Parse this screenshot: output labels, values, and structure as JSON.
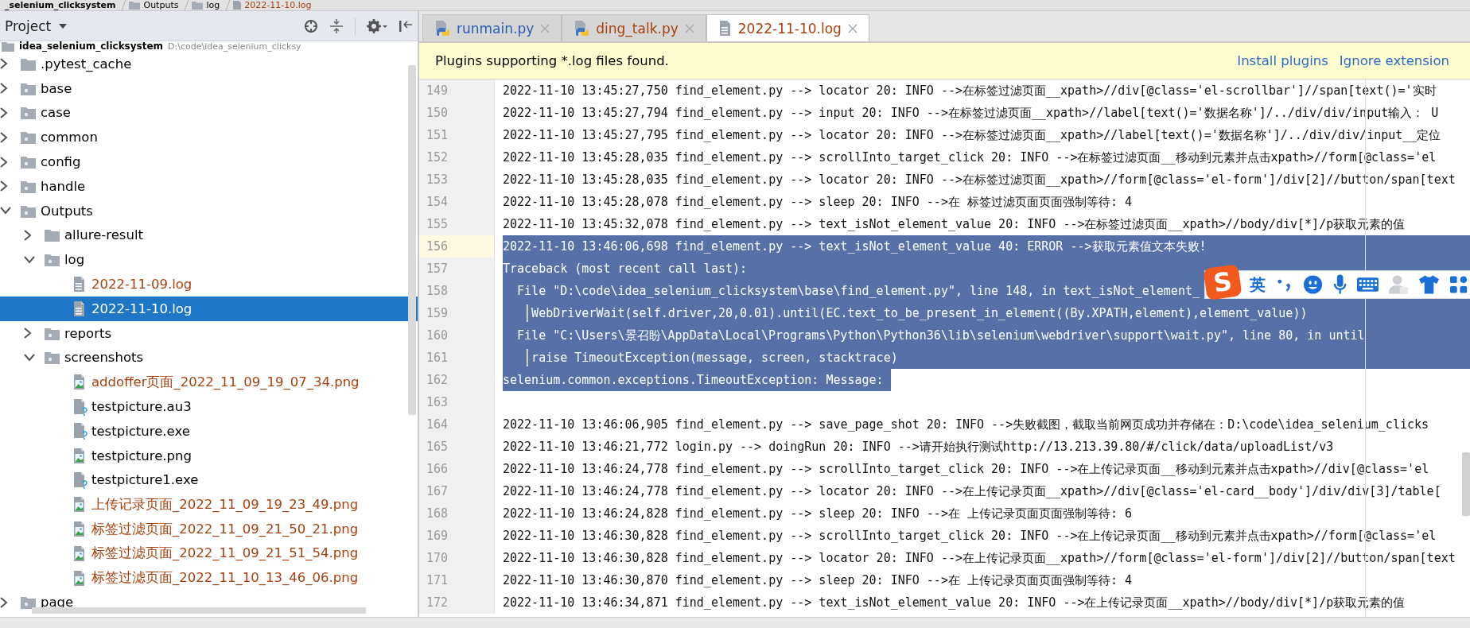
{
  "breadcrumbs": [
    {
      "text": "_selenium_clicksystem",
      "kind": "project"
    },
    {
      "text": "Outputs",
      "kind": "folder"
    },
    {
      "text": "log",
      "kind": "folder"
    },
    {
      "text": "2022-11-10.log",
      "kind": "log-file"
    }
  ],
  "project_panel": {
    "title": "Project",
    "root": {
      "name": "idea_selenium_clicksystem",
      "path": "D:\\code\\idea_selenium_clicksy"
    },
    "tree": [
      {
        "name": ".pytest_cache",
        "kind": "folder",
        "expanded": false,
        "selected": false,
        "color": "#000000"
      },
      {
        "name": "base",
        "kind": "package",
        "expanded": false,
        "selected": false,
        "color": "#000000"
      },
      {
        "name": "case",
        "kind": "package",
        "expanded": false,
        "selected": false,
        "color": "#000000"
      },
      {
        "name": "common",
        "kind": "package",
        "expanded": false,
        "selected": false,
        "color": "#000000"
      },
      {
        "name": "config",
        "kind": "package",
        "expanded": false,
        "selected": false,
        "color": "#000000"
      },
      {
        "name": "handle",
        "kind": "package",
        "expanded": false,
        "selected": false,
        "color": "#000000"
      },
      {
        "name": "Outputs",
        "kind": "package",
        "expanded": true,
        "selected": false,
        "color": "#000000",
        "children": [
          {
            "name": "allure-result",
            "kind": "folder",
            "expanded": false,
            "selected": false,
            "color": "#000000"
          },
          {
            "name": "log",
            "kind": "package",
            "expanded": true,
            "selected": false,
            "color": "#000000",
            "children": [
              {
                "name": "2022-11-09.log",
                "kind": "log-file",
                "selected": false,
                "color": "#a8400d"
              },
              {
                "name": "2022-11-10.log",
                "kind": "log-file",
                "selected": true
              }
            ]
          },
          {
            "name": "reports",
            "kind": "package",
            "expanded": false,
            "selected": false,
            "color": "#000000"
          },
          {
            "name": "screenshots",
            "kind": "package",
            "expanded": true,
            "selected": false,
            "color": "#000000",
            "children": [
              {
                "name": "addoffer页面_2022_11_09_19_07_34.png",
                "kind": "image-file",
                "selected": false,
                "color": "#a8400d"
              },
              {
                "name": "testpicture.au3",
                "kind": "unknown-file",
                "selected": false,
                "color": "#000000"
              },
              {
                "name": "testpicture.exe",
                "kind": "unknown-file",
                "selected": false,
                "color": "#000000"
              },
              {
                "name": "testpicture.png",
                "kind": "image-file",
                "selected": false,
                "color": "#000000"
              },
              {
                "name": "testpicture1.exe",
                "kind": "unknown-file",
                "selected": false,
                "color": "#000000"
              },
              {
                "name": "上传记录页面_2022_11_09_19_23_49.png",
                "kind": "image-file",
                "selected": false,
                "color": "#a8400d"
              },
              {
                "name": "标签过滤页面_2022_11_09_21_50_21.png",
                "kind": "image-file",
                "selected": false,
                "color": "#a8400d"
              },
              {
                "name": "标签过滤页面_2022_11_09_21_51_54.png",
                "kind": "image-file",
                "selected": false,
                "color": "#a8400d"
              },
              {
                "name": "标签过滤页面_2022_11_10_13_46_06.png",
                "kind": "image-file",
                "selected": false,
                "color": "#a8400d"
              }
            ]
          }
        ]
      },
      {
        "name": "page",
        "kind": "package",
        "expanded": false,
        "selected": false,
        "color": "#000000"
      }
    ]
  },
  "tabs": [
    {
      "label": "runmain.py",
      "kind": "python",
      "selected": false,
      "color": "#2a5cb0"
    },
    {
      "label": "ding_talk.py",
      "kind": "python",
      "selected": false,
      "color": "#a8400d"
    },
    {
      "label": "2022-11-10.log",
      "kind": "log",
      "selected": true,
      "color": "#a8400d"
    }
  ],
  "banner": {
    "message": "Plugins supporting *.log files found.",
    "links": [
      "Install plugins",
      "Ignore extension"
    ]
  },
  "editor_lines": [
    {
      "number": "149",
      "text": "2022-11-10 13:45:27,750 find_element.py --> locator 20: INFO -->在标签过滤页面__xpath>//div[@class='el-scrollbar']//span[text()='实时",
      "selected": false,
      "current": false,
      "indent_guide": false
    },
    {
      "number": "150",
      "text": "2022-11-10 13:45:27,794 find_element.py --> input 20: INFO -->在标签过滤页面__xpath>//label[text()='数据名称']/../div/div/input输入： U",
      "selected": false,
      "current": false,
      "indent_guide": false
    },
    {
      "number": "151",
      "text": "2022-11-10 13:45:27,795 find_element.py --> locator 20: INFO -->在标签过滤页面__xpath>//label[text()='数据名称']/../div/div/input__定位",
      "selected": false,
      "current": false,
      "indent_guide": false
    },
    {
      "number": "152",
      "text": "2022-11-10 13:45:28,035 find_element.py --> scrollInto_target_click 20: INFO -->在标签过滤页面__移动到元素并点击xpath>//form[@class='el",
      "selected": false,
      "current": false,
      "indent_guide": false
    },
    {
      "number": "153",
      "text": "2022-11-10 13:45:28,035 find_element.py --> locator 20: INFO -->在标签过滤页面__xpath>//form[@class='el-form']/div[2]//button/span[text",
      "selected": false,
      "current": false,
      "indent_guide": false
    },
    {
      "number": "154",
      "text": "2022-11-10 13:45:28,078 find_element.py --> sleep 20: INFO -->在 标签过滤页面页面强制等待: 4",
      "selected": false,
      "current": false,
      "indent_guide": false
    },
    {
      "number": "155",
      "text": "2022-11-10 13:45:32,078 find_element.py --> text_isNot_element_value 20: INFO -->在标签过滤页面__xpath>//body/div[*]/p获取元素的值",
      "selected": false,
      "current": false,
      "indent_guide": false
    },
    {
      "number": "156",
      "text": "2022-11-10 13:46:06,698 find_element.py --> text_isNot_element_value 40: ERROR -->获取元素值文本失败!",
      "selected": true,
      "current": true,
      "indent_guide": false
    },
    {
      "number": "157",
      "text": "Traceback (most recent call last):",
      "selected": true,
      "current": false,
      "indent_guide": false
    },
    {
      "number": "158",
      "text": "  File \"D:\\code\\idea_selenium_clicksystem\\base\\find_element.py\", line 148, in text_isNot_element_",
      "selected": true,
      "current": false,
      "indent_guide": false
    },
    {
      "number": "159",
      "text": "    WebDriverWait(self.driver,20,0.01).until(EC.text_to_be_present_in_element((By.XPATH,element),element_value))",
      "selected": true,
      "current": false,
      "indent_guide": true
    },
    {
      "number": "160",
      "text": "  File \"C:\\Users\\景召盼\\AppData\\Local\\Programs\\Python\\Python36\\lib\\selenium\\webdriver\\support\\wait.py\", line 80, in until",
      "selected": true,
      "current": false,
      "indent_guide": false
    },
    {
      "number": "161",
      "text": "    raise TimeoutException(message, screen, stacktrace)",
      "selected": true,
      "current": false,
      "indent_guide": true
    },
    {
      "number": "162",
      "text": "selenium.common.exceptions.TimeoutException: Message: ",
      "selected": true,
      "current": false,
      "indent_guide": false
    },
    {
      "number": "163",
      "selected": false,
      "current": false,
      "indent_guide": false
    },
    {
      "number": "164",
      "text": "2022-11-10 13:46:06,905 find_element.py --> save_page_shot 20: INFO -->失败截图，截取当前网页成功并存储在：D:\\code\\idea_selenium_clicks",
      "selected": false,
      "current": false,
      "indent_guide": false
    },
    {
      "number": "165",
      "text": "2022-11-10 13:46:21,772 login.py --> doingRun 20: INFO -->请开始执行测试http://13.213.39.80/#/click/data/uploadList/v3",
      "selected": false,
      "current": false,
      "indent_guide": false
    },
    {
      "number": "166",
      "text": "2022-11-10 13:46:24,778 find_element.py --> scrollInto_target_click 20: INFO -->在上传记录页面__移动到元素并点击xpath>//div[@class='el",
      "selected": false,
      "current": false,
      "indent_guide": false
    },
    {
      "number": "167",
      "text": "2022-11-10 13:46:24,778 find_element.py --> locator 20: INFO -->在上传记录页面__xpath>//div[@class='el-card__body']/div/div[3]/table[",
      "selected": false,
      "current": false,
      "indent_guide": false
    },
    {
      "number": "168",
      "text": "2022-11-10 13:46:24,828 find_element.py --> sleep 20: INFO -->在 上传记录页面页面强制等待: 6",
      "selected": false,
      "current": false,
      "indent_guide": false
    },
    {
      "number": "169",
      "text": "2022-11-10 13:46:30,828 find_element.py --> scrollInto_target_click 20: INFO -->在上传记录页面__移动到元素并点击xpath>//form[@class='el",
      "selected": false,
      "current": false,
      "indent_guide": false
    },
    {
      "number": "170",
      "text": "2022-11-10 13:46:30,828 find_element.py --> locator 20: INFO -->在上传记录页面__xpath>//form[@class='el-form']/div[2]//button/span[text",
      "selected": false,
      "current": false,
      "indent_guide": false
    },
    {
      "number": "171",
      "text": "2022-11-10 13:46:30,870 find_element.py --> sleep 20: INFO -->在 上传记录页面页面强制等待: 4",
      "selected": false,
      "current": false,
      "indent_guide": false
    },
    {
      "number": "172",
      "text": "2022-11-10 13:46:34,871 find_element.py --> text_isNot_element_value 20: INFO -->在上传记录页面__xpath>//body/div[*]/p获取元素的值",
      "selected": false,
      "current": false,
      "indent_guide": false
    }
  ],
  "ime_toolbar": {
    "logo": "S",
    "mode": "英"
  }
}
